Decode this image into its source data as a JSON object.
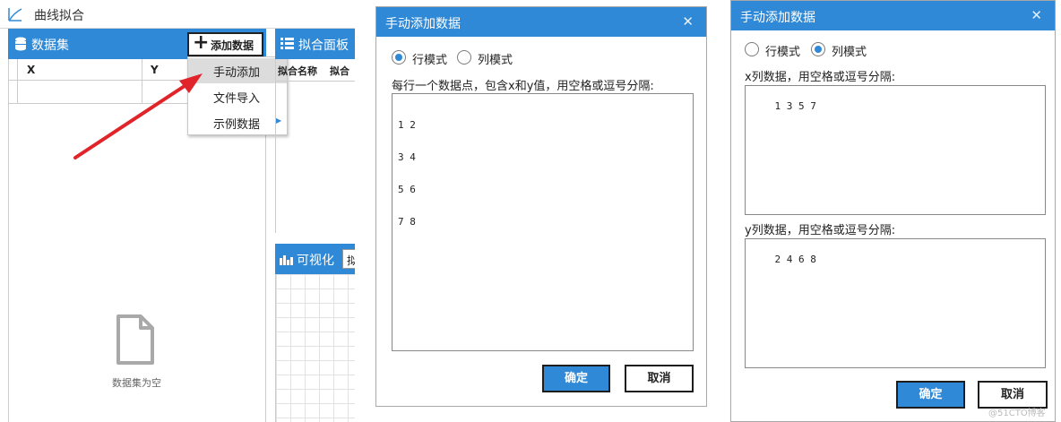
{
  "app": {
    "title": "曲线拟合",
    "dataset": {
      "header": "数据集",
      "add_button": "添加数据",
      "columns": [
        "X",
        "Y"
      ],
      "empty_text": "数据集为空"
    },
    "add_menu": {
      "items": [
        {
          "label": "手动添加",
          "has_submenu": false
        },
        {
          "label": "文件导入",
          "has_submenu": false
        },
        {
          "label": "示例数据",
          "has_submenu": true
        }
      ]
    },
    "fit_panel": {
      "header": "拟合面板",
      "columns": [
        "拟合名称",
        "拟合"
      ]
    },
    "viz_panel": {
      "header": "可视化",
      "control_text": "拟"
    }
  },
  "dialog_row": {
    "title": "手动添加数据",
    "close": "✕",
    "modes": [
      {
        "label": "行模式",
        "selected": true
      },
      {
        "label": "列模式",
        "selected": false
      }
    ],
    "instruction": "每行一个数据点，包含x和y值，用空格或逗号分隔:",
    "lines": [
      "1 2",
      "3 4",
      "5 6",
      "7 8"
    ],
    "ok": "确定",
    "cancel": "取消"
  },
  "dialog_col": {
    "title": "手动添加数据",
    "close": "✕",
    "modes": [
      {
        "label": "行模式",
        "selected": false
      },
      {
        "label": "列模式",
        "selected": true
      }
    ],
    "x_label": "x列数据，用空格或逗号分隔:",
    "x_value": "1 3 5 7",
    "y_label": "y列数据，用空格或逗号分隔:",
    "y_value": "2 4 6 8",
    "ok": "确定",
    "cancel": "取消"
  },
  "watermark": "@51CTO博客",
  "colors": {
    "accent": "#2f89d6",
    "arrow": "#e0242a",
    "icon": "#a9a9a9"
  }
}
